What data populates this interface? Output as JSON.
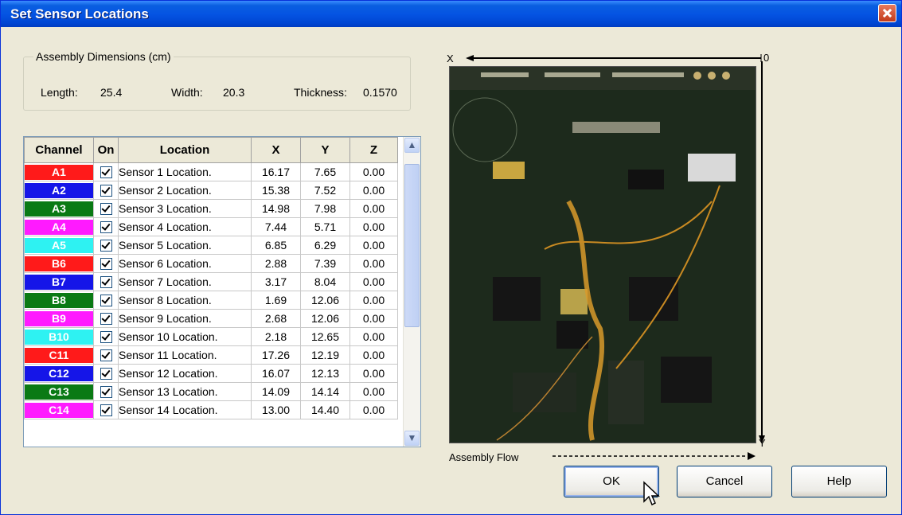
{
  "window": {
    "title": "Set Sensor Locations"
  },
  "dimensions": {
    "legend": "Assembly Dimensions (cm)",
    "length_label": "Length:",
    "length_value": "25.4",
    "width_label": "Width:",
    "width_value": "20.3",
    "thickness_label": "Thickness:",
    "thickness_value": "0.1570"
  },
  "table": {
    "headers": [
      "Channel",
      "On",
      "Location",
      "X",
      "Y",
      "Z"
    ],
    "rows": [
      {
        "channel": "A1",
        "color": "#ff1a1a",
        "on": true,
        "location": "Sensor 1 Location.",
        "x": "16.17",
        "y": "7.65",
        "z": "0.00"
      },
      {
        "channel": "A2",
        "color": "#1515e8",
        "on": true,
        "location": "Sensor 2 Location.",
        "x": "15.38",
        "y": "7.52",
        "z": "0.00"
      },
      {
        "channel": "A3",
        "color": "#0a7a14",
        "on": true,
        "location": "Sensor 3 Location.",
        "x": "14.98",
        "y": "7.98",
        "z": "0.00"
      },
      {
        "channel": "A4",
        "color": "#ff1aff",
        "on": true,
        "location": "Sensor 4 Location.",
        "x": "7.44",
        "y": "5.71",
        "z": "0.00"
      },
      {
        "channel": "A5",
        "color": "#2ef2f2",
        "on": true,
        "location": "Sensor 5 Location.",
        "x": "6.85",
        "y": "6.29",
        "z": "0.00"
      },
      {
        "channel": "B6",
        "color": "#ff1a1a",
        "on": true,
        "location": "Sensor 6 Location.",
        "x": "2.88",
        "y": "7.39",
        "z": "0.00"
      },
      {
        "channel": "B7",
        "color": "#1515e8",
        "on": true,
        "location": "Sensor 7 Location.",
        "x": "3.17",
        "y": "8.04",
        "z": "0.00"
      },
      {
        "channel": "B8",
        "color": "#0a7a14",
        "on": true,
        "location": "Sensor 8 Location.",
        "x": "1.69",
        "y": "12.06",
        "z": "0.00"
      },
      {
        "channel": "B9",
        "color": "#ff1aff",
        "on": true,
        "location": "Sensor 9 Location.",
        "x": "2.68",
        "y": "12.06",
        "z": "0.00"
      },
      {
        "channel": "B10",
        "color": "#2ef2f2",
        "on": true,
        "location": "Sensor 10 Location.",
        "x": "2.18",
        "y": "12.65",
        "z": "0.00"
      },
      {
        "channel": "C11",
        "color": "#ff1a1a",
        "on": true,
        "location": "Sensor 11 Location.",
        "x": "17.26",
        "y": "12.19",
        "z": "0.00"
      },
      {
        "channel": "C12",
        "color": "#1515e8",
        "on": true,
        "location": "Sensor 12 Location.",
        "x": "16.07",
        "y": "12.13",
        "z": "0.00"
      },
      {
        "channel": "C13",
        "color": "#0a7a14",
        "on": true,
        "location": "Sensor 13 Location.",
        "x": "14.09",
        "y": "14.14",
        "z": "0.00"
      },
      {
        "channel": "C14",
        "color": "#ff1aff",
        "on": true,
        "location": "Sensor 14 Location.",
        "x": "13.00",
        "y": "14.40",
        "z": "0.00"
      }
    ]
  },
  "axes": {
    "x_label": "X",
    "zero_label": "0",
    "y_label": "Y",
    "flow_label": "Assembly Flow"
  },
  "image": {
    "icon": "circuit-board-photo"
  },
  "buttons": {
    "ok": "OK",
    "cancel": "Cancel",
    "help": "Help"
  },
  "scrollbar": {
    "up": "▲",
    "down": "▼"
  }
}
